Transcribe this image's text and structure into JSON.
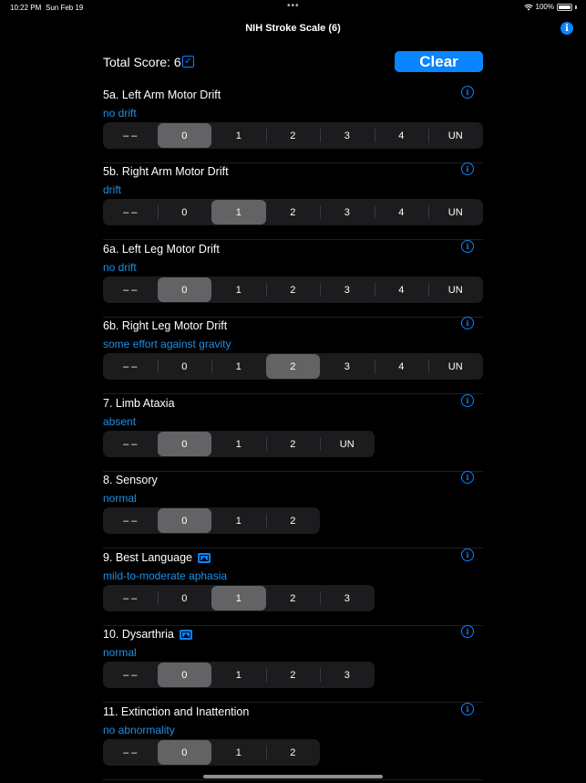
{
  "status_bar": {
    "time": "10:22 PM",
    "date": "Sun Feb 19",
    "dots": "•••",
    "battery": "100%"
  },
  "nav": {
    "title": "NIH Stroke Scale (6)"
  },
  "total": {
    "label": "Total Score: 6",
    "checkbox": "✓",
    "clear_label": "Clear"
  },
  "items": [
    {
      "title": "5a. Left Arm Motor Drift",
      "subtitle": "no drift",
      "has_image": false,
      "options": [
        "– –",
        "0",
        "1",
        "2",
        "3",
        "4",
        "UN"
      ],
      "selected": 1
    },
    {
      "title": "5b. Right Arm Motor Drift",
      "subtitle": "drift",
      "has_image": false,
      "options": [
        "– –",
        "0",
        "1",
        "2",
        "3",
        "4",
        "UN"
      ],
      "selected": 2
    },
    {
      "title": "6a. Left Leg Motor Drift",
      "subtitle": "no drift",
      "has_image": false,
      "options": [
        "– –",
        "0",
        "1",
        "2",
        "3",
        "4",
        "UN"
      ],
      "selected": 1
    },
    {
      "title": "6b. Right Leg Motor Drift",
      "subtitle": "some effort against gravity",
      "has_image": false,
      "options": [
        "– –",
        "0",
        "1",
        "2",
        "3",
        "4",
        "UN"
      ],
      "selected": 3
    },
    {
      "title": "7. Limb Ataxia",
      "subtitle": "absent",
      "has_image": false,
      "options": [
        "– –",
        "0",
        "1",
        "2",
        "UN"
      ],
      "selected": 1
    },
    {
      "title": "8. Sensory",
      "subtitle": "normal",
      "has_image": false,
      "options": [
        "– –",
        "0",
        "1",
        "2"
      ],
      "selected": 1
    },
    {
      "title": "9. Best Language",
      "subtitle": "mild-to-moderate aphasia",
      "has_image": true,
      "options": [
        "– –",
        "0",
        "1",
        "2",
        "3"
      ],
      "selected": 2
    },
    {
      "title": "10. Dysarthria",
      "subtitle": "normal",
      "has_image": true,
      "options": [
        "– –",
        "0",
        "1",
        "2",
        "3"
      ],
      "selected": 1
    },
    {
      "title": "11. Extinction and Inattention",
      "subtitle": "no abnormality",
      "has_image": false,
      "options": [
        "– –",
        "0",
        "1",
        "2"
      ],
      "selected": 1
    }
  ],
  "icons": {
    "info": "info-icon",
    "image": "image-icon",
    "wifi": "wifi-icon",
    "battery": "battery-icon"
  },
  "colors": {
    "accent": "#0a84ff",
    "subtitle": "#1e90e6",
    "segment_bg": "#1c1c1e",
    "segment_selected": "#636366"
  }
}
